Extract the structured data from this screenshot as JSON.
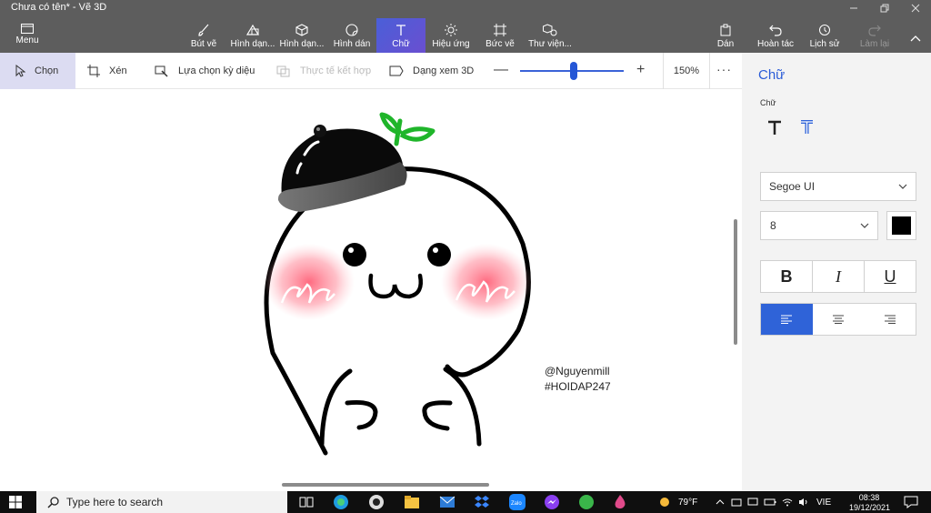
{
  "window": {
    "title": "Chưa có tên* - Vẽ 3D"
  },
  "ribbon": {
    "menu_label": "Menu",
    "tools": [
      {
        "label": "Bút vẽ"
      },
      {
        "label": "Hình dạn..."
      },
      {
        "label": "Hình dạn..."
      },
      {
        "label": "Hình dán"
      },
      {
        "label": "Chữ"
      },
      {
        "label": "Hiệu ứng"
      },
      {
        "label": "Bức vẽ"
      },
      {
        "label": "Thư viện..."
      }
    ],
    "right_tools": [
      {
        "label": "Dán"
      },
      {
        "label": "Hoàn tác"
      },
      {
        "label": "Lịch sử"
      },
      {
        "label": "Làm lại"
      }
    ]
  },
  "toolbar": {
    "select_label": "Chọn",
    "crop_label": "Xén",
    "magic_label": "Lựa chọn kỳ diệu",
    "mixed_label": "Thực tế kết hợp",
    "view3d_label": "Dạng xem 3D",
    "zoom_minus": "—",
    "zoom_plus": "+",
    "zoom_value": "150%",
    "zoom_level": 0.52,
    "more": "···"
  },
  "canvas": {
    "signature_line1": "@Nguyenmill",
    "signature_line2": "#HOIDAP247"
  },
  "panel": {
    "title": "Chữ",
    "subtitle": "Chữ",
    "font_name": "Segoe UI",
    "font_size": "8",
    "text_color": "#000000",
    "bold": "B",
    "italic": "I",
    "underline": "U"
  },
  "taskbar": {
    "search_placeholder": "Type here to search",
    "temperature": "79°F",
    "language": "VIE",
    "time": "08:38",
    "date": "19/12/2021"
  },
  "colors": {
    "accent": "#2f63d8",
    "ribbon": "#5d5d5d"
  }
}
